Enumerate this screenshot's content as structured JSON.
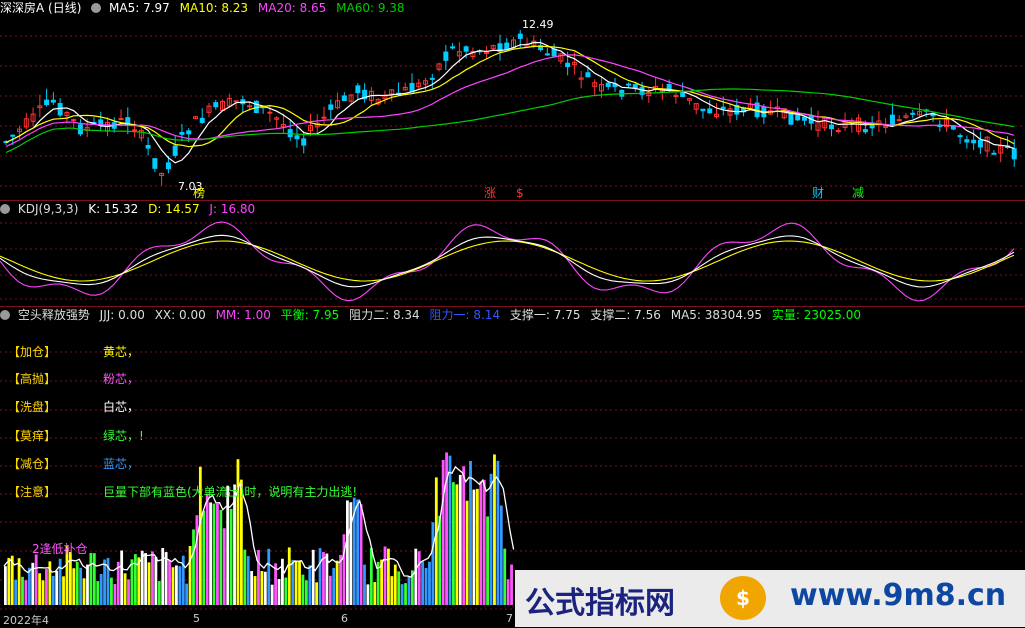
{
  "price_panel": {
    "title": "深深房A (日线)",
    "ma5": "MA5: 7.97",
    "ma10": "MA10: 8.23",
    "ma20": "MA20: 8.65",
    "ma60": "MA60: 9.38",
    "high_label": "12.49",
    "low_label": "7.03",
    "markers": [
      "榜",
      "涨",
      "$",
      "财",
      "减"
    ]
  },
  "kdj_panel": {
    "title": "KDJ(9,3,3)",
    "k": "K: 15.32",
    "d": "D: 14.57",
    "j": "J: 16.80"
  },
  "indicator_panel": {
    "title": "空头释放强势",
    "jjj": "JJJ: 0.00",
    "xx": "XX: 0.00",
    "mm": "MM: 1.00",
    "pingheng": "平衡: 7.95",
    "zuli2": "阻力二: 8.34",
    "zuli1": "阻力一: 8.14",
    "zhicheng1": "支撑一: 7.75",
    "zhicheng2": "支撑二: 7.56",
    "ma5": "MA5: 38304.95",
    "shiliang": "实量: 23025.00",
    "note_overlay": "2逢低补仓"
  },
  "legend": [
    {
      "key": "【加仓】",
      "text": "黄芯，",
      "color": "#ffff00"
    },
    {
      "key": "【高抛】",
      "text": "粉芯，",
      "color": "#ff55ff"
    },
    {
      "key": "【洗盘】",
      "text": "白芯，",
      "color": "#ffffff"
    },
    {
      "key": "【莫痒】",
      "text": "绿芯，!",
      "color": "#33ff33"
    },
    {
      "key": "【减仓】",
      "text": "蓝芯，",
      "color": "#3399ff"
    },
    {
      "key": "【注意】",
      "text": "巨量下部有蓝色(大单流出)时，说明有主力出逃!",
      "color": "#33ff33"
    }
  ],
  "date_axis": [
    "2022年4",
    "5",
    "6",
    "7"
  ],
  "watermark": {
    "left": "公式指标网",
    "logo": "$",
    "right": "www.9m8.cn"
  },
  "colors": {
    "up": "#ff3333",
    "down": "#00ccff",
    "ma5": "#ffffff",
    "ma10": "#ffff00",
    "ma20": "#ff44ff",
    "ma60": "#00cc00",
    "grid": "#7a1020"
  }
}
